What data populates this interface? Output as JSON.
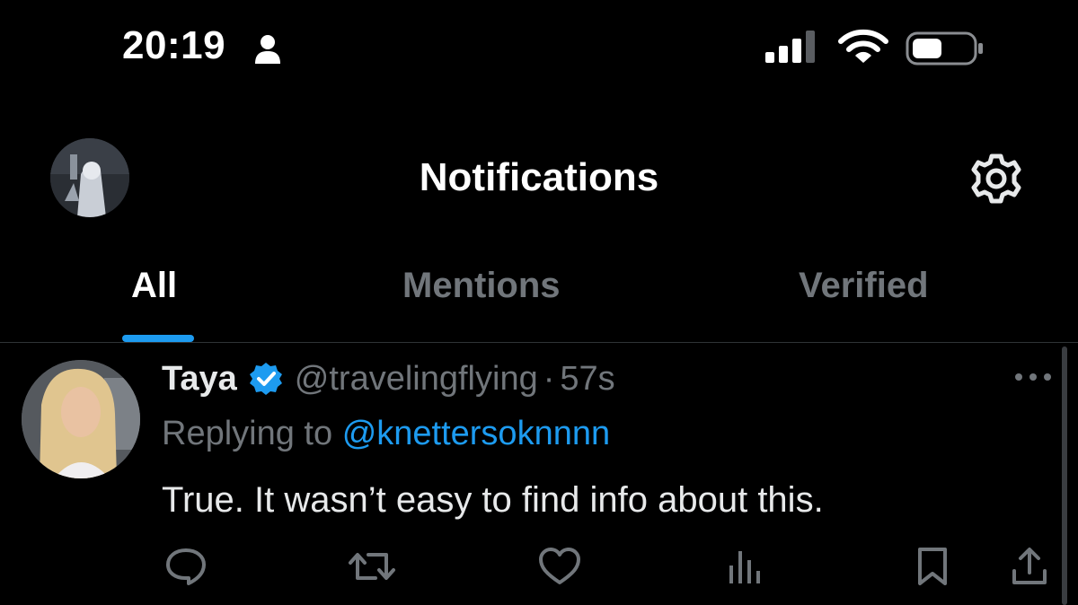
{
  "status_bar": {
    "time": "20:19",
    "icons": [
      "person-icon",
      "cellular-signal-icon",
      "wifi-icon",
      "battery-icon"
    ]
  },
  "header": {
    "title": "Notifications",
    "left": "profile-avatar",
    "right": "gear-icon"
  },
  "tabs": [
    {
      "label": "All",
      "active": true
    },
    {
      "label": "Mentions",
      "active": false
    },
    {
      "label": "Verified",
      "active": false
    }
  ],
  "tweet": {
    "author_name": "Taya",
    "handle": "@travelingflying",
    "separator": "·",
    "time": "57s",
    "reply_prefix": "Replying to",
    "reply_to": "@knettersoknnnn",
    "text": "True. It wasn’t easy to find info about this.",
    "actions": [
      "reply-icon",
      "retweet-icon",
      "like-icon",
      "views-icon",
      "bookmark-icon",
      "share-icon"
    ]
  },
  "colors": {
    "background": "#000000",
    "accent": "#1d9bf0",
    "secondary_text": "#71767b",
    "primary_text": "#e7e9ea"
  }
}
